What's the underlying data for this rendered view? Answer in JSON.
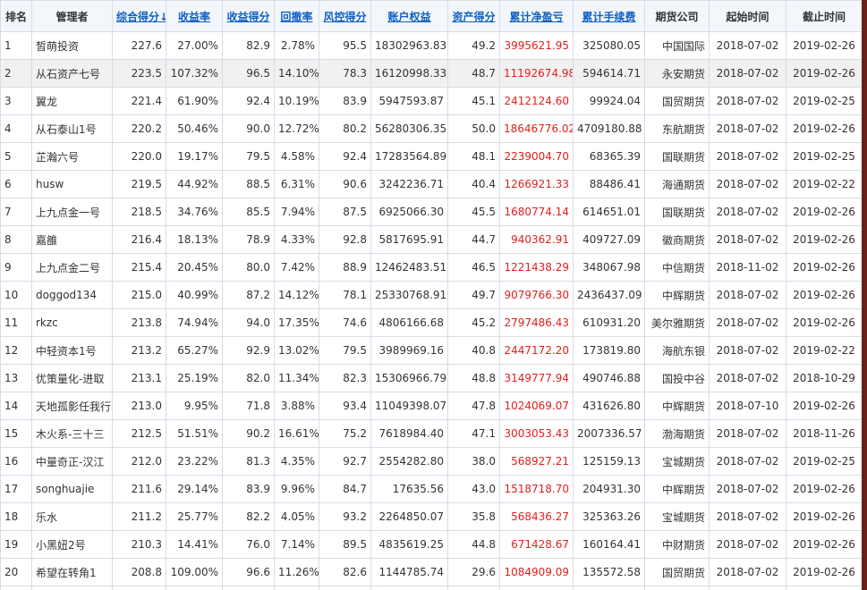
{
  "columns": [
    {
      "label": "排名",
      "sortable": false
    },
    {
      "label": "管理者",
      "sortable": false
    },
    {
      "label": "综合得分",
      "sortable": true,
      "sorted": true
    },
    {
      "label": "收益率",
      "sortable": true
    },
    {
      "label": "收益得分",
      "sortable": true
    },
    {
      "label": "回撤率",
      "sortable": true
    },
    {
      "label": "风控得分",
      "sortable": true
    },
    {
      "label": "账户权益",
      "sortable": true
    },
    {
      "label": "资产得分",
      "sortable": true
    },
    {
      "label": "累计净盈亏",
      "sortable": true
    },
    {
      "label": "累计手续费",
      "sortable": true
    },
    {
      "label": "期货公司",
      "sortable": false
    },
    {
      "label": "起始时间",
      "sortable": false
    },
    {
      "label": "截止时间",
      "sortable": false
    }
  ],
  "sort_arrow": "↓",
  "highlight_row": 1,
  "rows": [
    [
      "1",
      "皙萌投资",
      "227.6",
      "27.00%",
      "82.9",
      "2.78%",
      "95.5",
      "18302963.83",
      "49.2",
      "3995621.95",
      "325080.05",
      "中国国际",
      "2018-07-02",
      "2019-02-26"
    ],
    [
      "2",
      "从石资产七号",
      "223.5",
      "107.32%",
      "96.5",
      "14.10%",
      "78.3",
      "16120998.33",
      "48.7",
      "11192674.98",
      "594614.71",
      "永安期货",
      "2018-07-02",
      "2019-02-26"
    ],
    [
      "3",
      "翼龙",
      "221.4",
      "61.90%",
      "92.4",
      "10.19%",
      "83.9",
      "5947593.87",
      "45.1",
      "2412124.60",
      "99924.04",
      "国贸期货",
      "2018-07-02",
      "2019-02-25"
    ],
    [
      "4",
      "从石泰山1号",
      "220.2",
      "50.46%",
      "90.0",
      "12.72%",
      "80.2",
      "56280306.35",
      "50.0",
      "18646776.02",
      "4709180.88",
      "东航期货",
      "2018-07-02",
      "2019-02-26"
    ],
    [
      "5",
      "芷瀚六号",
      "220.0",
      "19.17%",
      "79.5",
      "4.58%",
      "92.4",
      "17283564.89",
      "48.1",
      "2239004.70",
      "68365.39",
      "国联期货",
      "2018-07-02",
      "2019-02-25"
    ],
    [
      "6",
      "husw",
      "219.5",
      "44.92%",
      "88.5",
      "6.31%",
      "90.6",
      "3242236.71",
      "40.4",
      "1266921.33",
      "88486.41",
      "海通期货",
      "2018-07-02",
      "2019-02-22"
    ],
    [
      "7",
      "上九点金一号",
      "218.5",
      "34.76%",
      "85.5",
      "7.94%",
      "87.5",
      "6925066.30",
      "45.5",
      "1680774.14",
      "614651.01",
      "国联期货",
      "2018-07-02",
      "2019-02-26"
    ],
    [
      "8",
      "嘉雒",
      "216.4",
      "18.13%",
      "78.9",
      "4.33%",
      "92.8",
      "5817695.91",
      "44.7",
      "940362.91",
      "409727.09",
      "徽商期货",
      "2018-07-02",
      "2019-02-26"
    ],
    [
      "9",
      "上九点金二号",
      "215.4",
      "20.45%",
      "80.0",
      "7.42%",
      "88.9",
      "12462483.51",
      "46.5",
      "1221438.29",
      "348067.98",
      "中信期货",
      "2018-11-02",
      "2019-02-26"
    ],
    [
      "10",
      "doggod134",
      "215.0",
      "40.99%",
      "87.2",
      "14.12%",
      "78.1",
      "25330768.91",
      "49.7",
      "9079766.30",
      "2436437.09",
      "中辉期货",
      "2018-07-02",
      "2019-02-26"
    ],
    [
      "11",
      "rkzc",
      "213.8",
      "74.94%",
      "94.0",
      "17.35%",
      "74.6",
      "4806166.68",
      "45.2",
      "2797486.43",
      "610931.20",
      "美尔雅期货",
      "2018-07-02",
      "2019-02-26"
    ],
    [
      "12",
      "中轻资本1号",
      "213.2",
      "65.27%",
      "92.9",
      "13.02%",
      "79.5",
      "3989969.16",
      "40.8",
      "2447172.20",
      "173819.80",
      "海航东银",
      "2018-07-02",
      "2019-02-22"
    ],
    [
      "13",
      "优策量化-进取",
      "213.1",
      "25.19%",
      "82.0",
      "11.34%",
      "82.3",
      "15306966.79",
      "48.8",
      "3149777.94",
      "490746.88",
      "国投中谷",
      "2018-07-02",
      "2018-10-29"
    ],
    [
      "14",
      "天地孤影任我行",
      "213.0",
      "9.95%",
      "71.8",
      "3.88%",
      "93.4",
      "11049398.07",
      "47.8",
      "1024069.07",
      "431626.80",
      "中辉期货",
      "2018-07-10",
      "2019-02-26"
    ],
    [
      "15",
      "木火系-三十三",
      "212.5",
      "51.51%",
      "90.2",
      "16.61%",
      "75.2",
      "7618984.40",
      "47.1",
      "3003053.43",
      "2007336.57",
      "渤海期货",
      "2018-07-02",
      "2018-11-26"
    ],
    [
      "16",
      "中量奇正-汉江",
      "212.0",
      "23.22%",
      "81.3",
      "4.35%",
      "92.7",
      "2554282.80",
      "38.0",
      "568927.21",
      "125159.13",
      "宝城期货",
      "2018-07-02",
      "2019-02-25"
    ],
    [
      "17",
      "songhuajie",
      "211.6",
      "29.14%",
      "83.9",
      "9.96%",
      "84.7",
      "17635.56",
      "43.0",
      "1518718.70",
      "204931.30",
      "中辉期货",
      "2018-07-02",
      "2019-02-26"
    ],
    [
      "18",
      "乐水",
      "211.2",
      "25.77%",
      "82.2",
      "4.05%",
      "93.2",
      "2264850.07",
      "35.8",
      "568436.27",
      "325363.26",
      "宝城期货",
      "2018-07-02",
      "2019-02-26"
    ],
    [
      "19",
      "小黑妞2号",
      "210.3",
      "14.41%",
      "76.0",
      "7.14%",
      "89.5",
      "4835619.25",
      "44.8",
      "671428.67",
      "160164.41",
      "中财期货",
      "2018-07-02",
      "2019-02-26"
    ],
    [
      "20",
      "希望在转角1",
      "208.8",
      "109.00%",
      "96.6",
      "11.26%",
      "82.6",
      "1144785.74",
      "29.6",
      "1084909.09",
      "135572.58",
      "国贸期货",
      "2018-07-02",
      "2019-02-26"
    ],
    [
      "",
      "",
      "",
      "",
      "",
      "",
      "",
      "",
      "",
      "",
      "",
      "",
      "",
      ""
    ]
  ],
  "colors": {
    "header_bg": "#f3f7fb",
    "link": "#0f60c2",
    "profit_red": "#e0201d",
    "border": "#d4dde7",
    "highlight": "#f1f1f1"
  }
}
